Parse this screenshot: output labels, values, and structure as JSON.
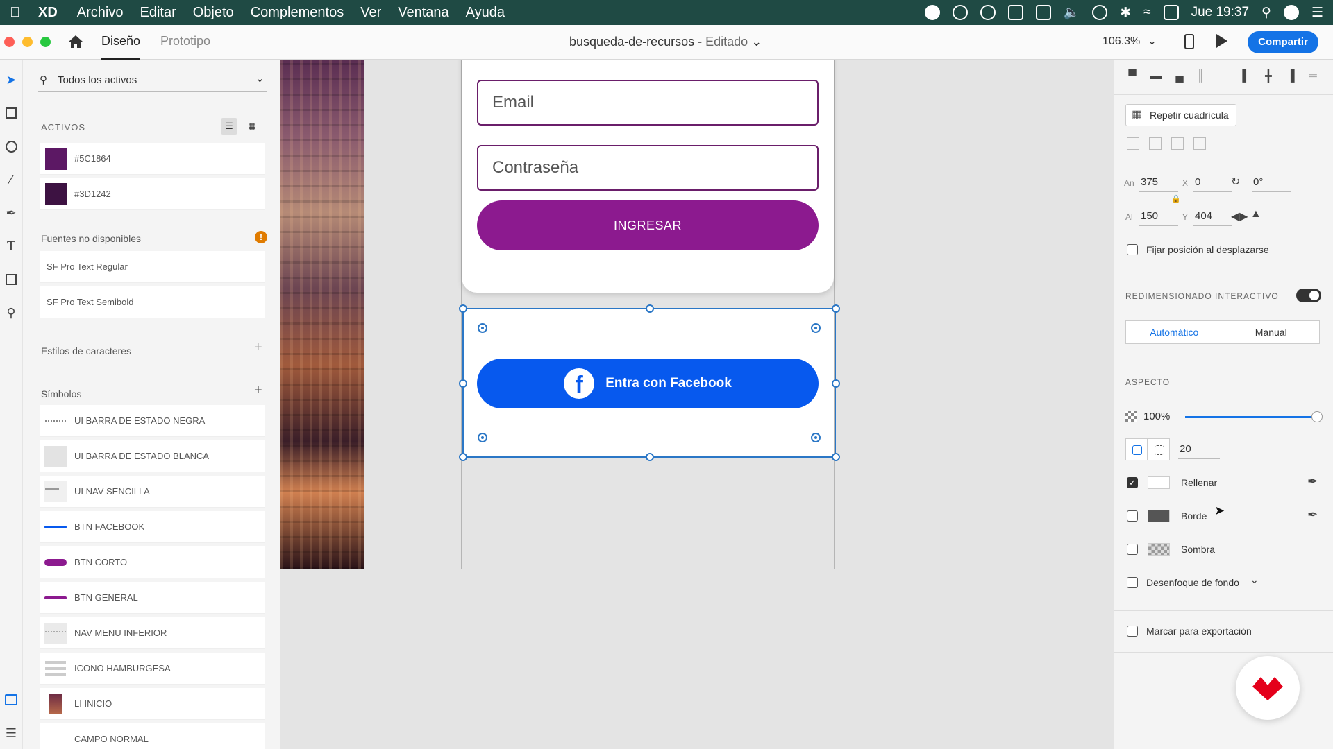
{
  "menubar": {
    "app": "XD",
    "items": [
      "Archivo",
      "Editar",
      "Objeto",
      "Complementos",
      "Ver",
      "Ventana",
      "Ayuda"
    ],
    "clock": "Jue 19:37"
  },
  "toolbar": {
    "tab_design": "Diseño",
    "tab_prototype": "Prototipo",
    "doc_name": "busqueda-de-recursos",
    "doc_status": "- Editado",
    "zoom": "106.3%",
    "share": "Compartir"
  },
  "assets": {
    "filter": "Todos los activos",
    "section": "ACTIVOS",
    "colors": [
      {
        "hex": "#5C1864",
        "label": "#5C1864"
      },
      {
        "hex": "#3D1242",
        "label": "#3D1242"
      }
    ],
    "fonts_title": "Fuentes no disponibles",
    "fonts": [
      "SF Pro Text Regular",
      "SF Pro Text Semibold"
    ],
    "char_styles": "Estilos de caracteres",
    "symbols_title": "Símbolos",
    "symbols": [
      "UI BARRA DE ESTADO NEGRA",
      "UI BARRA DE ESTADO BLANCA",
      "UI NAV SENCILLA",
      "BTN FACEBOOK",
      "BTN CORTO",
      "BTN GENERAL",
      "NAV MENU INFERIOR",
      "ICONO HAMBURGESA",
      "LI INICIO",
      "CAMPO NORMAL"
    ]
  },
  "canvas": {
    "email_placeholder": "Email",
    "password_placeholder": "Contraseña",
    "login_button": "INGRESAR",
    "facebook_button": "Entra con Facebook",
    "brand_purple": "#8c1a8f",
    "facebook_blue": "#0759ee"
  },
  "props": {
    "repeat_grid": "Repetir cuadrícula",
    "w_label": "An",
    "w": "375",
    "h_label": "Al",
    "h": "150",
    "x_label": "X",
    "x": "0",
    "y_label": "Y",
    "y": "404",
    "rotation": "0°",
    "fix_position": "Fijar posición al desplazarse",
    "responsive_title": "REDIMENSIONADO INTERACTIVO",
    "auto": "Automático",
    "manual": "Manual",
    "appearance_title": "ASPECTO",
    "opacity": "100%",
    "radius": "20",
    "fill": "Rellenar",
    "border": "Borde",
    "shadow": "Sombra",
    "bg_blur": "Desenfoque de fondo",
    "export": "Marcar para exportación"
  }
}
